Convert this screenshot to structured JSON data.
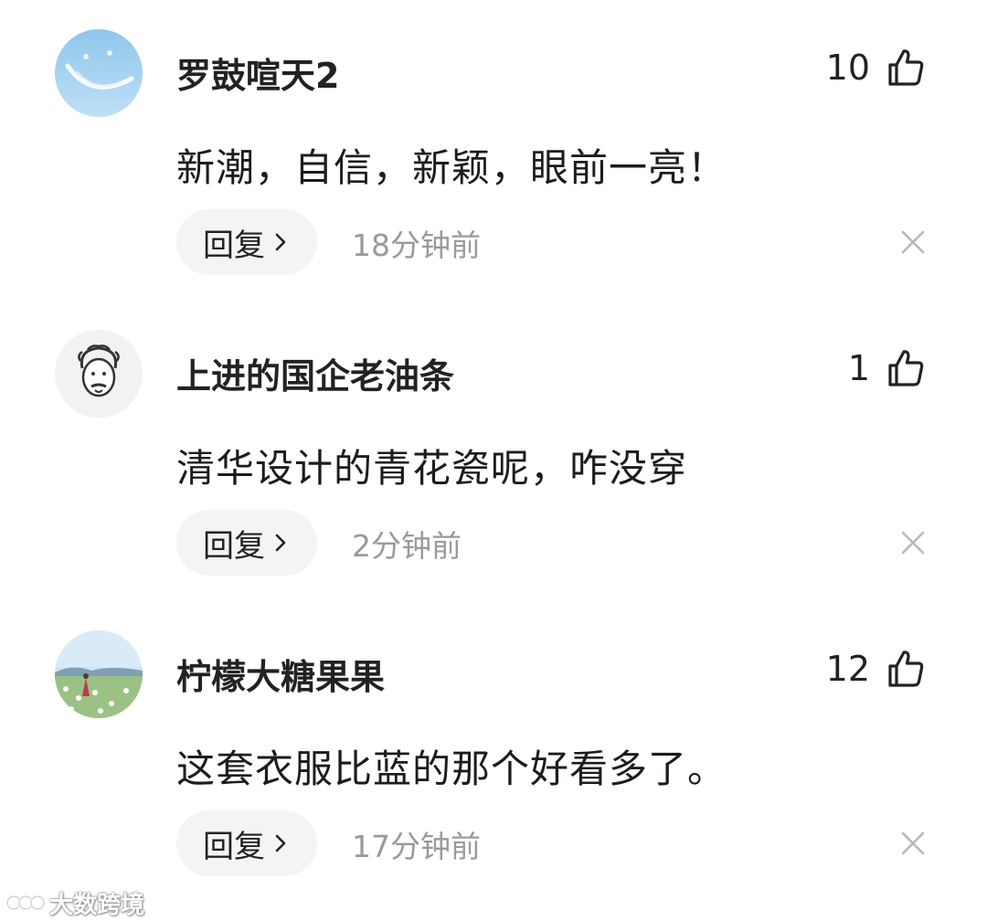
{
  "comments": [
    {
      "username": "罗鼓喧天2",
      "likes": "10",
      "text": "新潮，自信，新颖，眼前一亮！",
      "reply_label": "回复",
      "time": "18分钟前",
      "avatar": "sky-smile-avatar"
    },
    {
      "username": "上进的国企老油条",
      "likes": "1",
      "text": "清华设计的青花瓷呢，咋没穿",
      "reply_label": "回复",
      "time": "2分钟前",
      "avatar": "cartoon-face-avatar"
    },
    {
      "username": "柠檬大糖果果",
      "likes": "12",
      "text": "这套衣服比蓝的那个好看多了。",
      "reply_label": "回复",
      "time": "17分钟前",
      "avatar": "flower-field-avatar"
    }
  ],
  "icons": {
    "like": "thumbs-up-icon",
    "reply_arrow": "chevron-right-icon",
    "close": "close-icon"
  },
  "watermark": "大数跨境",
  "colors": {
    "text": "#222222",
    "muted": "#9a9a9a",
    "reply_bg": "#f4f4f4",
    "close": "#b8b8b8"
  }
}
